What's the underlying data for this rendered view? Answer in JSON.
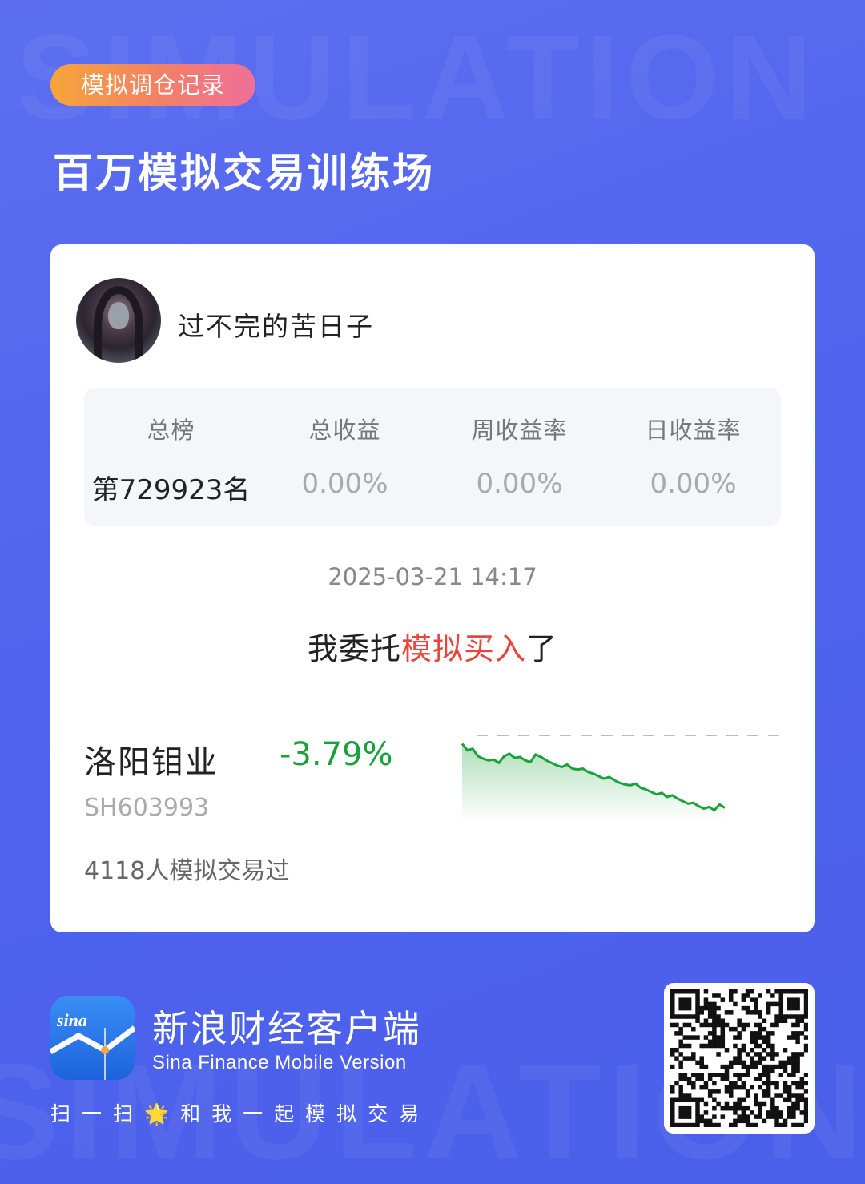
{
  "tag": "模拟调仓记录",
  "title": "百万模拟交易训练场",
  "watermark": [
    "SIMULATION",
    "SIMULATION"
  ],
  "user": {
    "name": "过不完的苦日子"
  },
  "stats": [
    {
      "label": "总榜",
      "value": "第729923名"
    },
    {
      "label": "总收益",
      "value": "0.00%"
    },
    {
      "label": "周收益率",
      "value": "0.00%"
    },
    {
      "label": "日收益率",
      "value": "0.00%"
    }
  ],
  "datetime": "2025-03-21 14:17",
  "action": {
    "prefix": "我委托",
    "highlight": "模拟买入",
    "suffix": "了"
  },
  "stock": {
    "name": "洛阳钼业",
    "change": "-3.79%",
    "code": "SH603993",
    "traders": "4118人模拟交易过"
  },
  "chart_data": {
    "type": "line",
    "title": "",
    "y": [
      0.0,
      -0.8,
      -0.6,
      -1.5,
      -1.8,
      -2.0,
      -1.9,
      -2.3,
      -1.5,
      -1.2,
      -1.7,
      -1.6,
      -2.0,
      -2.2,
      -1.3,
      -1.6,
      -2.0,
      -2.3,
      -2.6,
      -2.8,
      -2.5,
      -3.0,
      -3.1,
      -3.0,
      -3.4,
      -3.6,
      -3.9,
      -4.2,
      -4.0,
      -4.4,
      -4.7,
      -4.9,
      -5.0,
      -4.8,
      -5.3,
      -5.5,
      -5.8,
      -6.1,
      -5.9,
      -6.4,
      -6.2,
      -6.6,
      -6.9,
      -7.2,
      -7.1,
      -7.5,
      -7.8,
      -7.6,
      -8.0,
      -7.3,
      -7.7
    ],
    "ylim": [
      -9,
      1
    ],
    "baseline": 1.0,
    "colors": {
      "line": "#1aa13a",
      "fill": "#1aa13a",
      "baseline": "#bbbbbb"
    }
  },
  "footer": {
    "logo_text": "sina",
    "brand": "新浪财经客户端",
    "sub": "Sina Finance Mobile Version",
    "slogan": "扫一扫🌟和我一起模拟交易"
  }
}
